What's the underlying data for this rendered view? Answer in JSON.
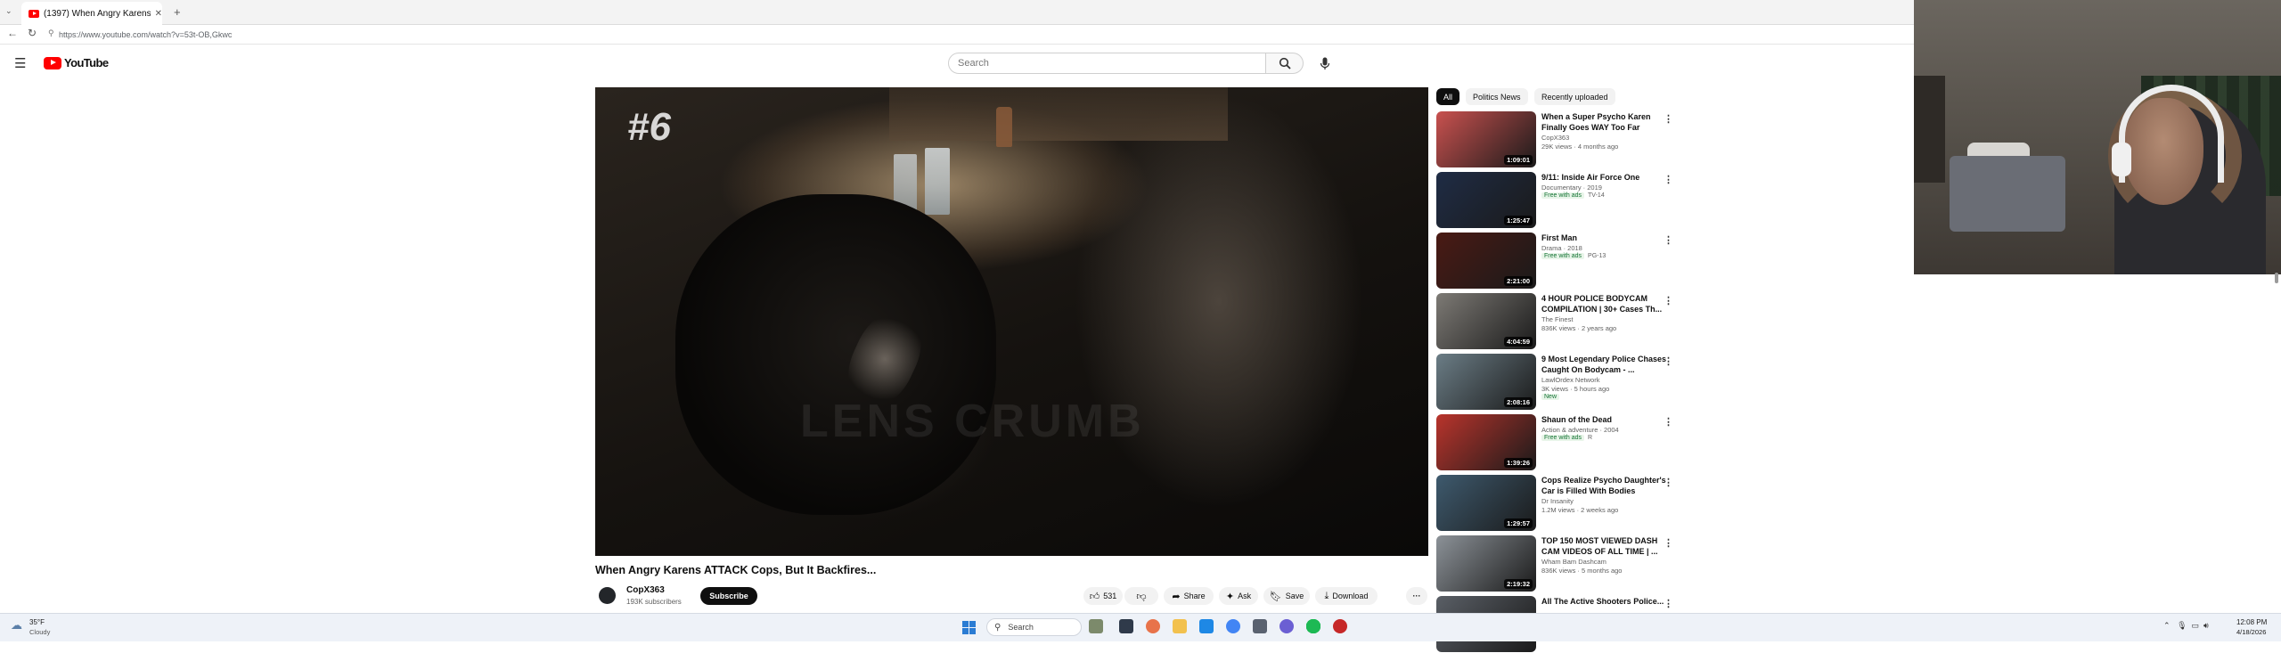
{
  "browser": {
    "tab_title": "(1397) When Angry Karens A",
    "url": "https://www.youtube.com/watch?v=53t-OB,Gkwc"
  },
  "header": {
    "logo_text": "YouTube",
    "search_placeholder": "Search"
  },
  "video": {
    "overlay_text": "#6",
    "title": "When Angry Karens ATTACK Cops, But It Backfires...",
    "channel": "CopX363",
    "subscribers": "193K subscribers",
    "subscribe_label": "Subscribe",
    "likes": "531",
    "share_label": "Share",
    "ask_label": "Ask",
    "save_label": "Save",
    "download_label": "Download"
  },
  "chips": [
    "All",
    "Politics News",
    "Recently uploaded"
  ],
  "recommendations": [
    {
      "title": "When a Super Psycho Karen Finally Goes WAY Too Far",
      "channel": "CopX363",
      "meta": "29K views · 4 months ago",
      "duration": "1:09:01",
      "badge": "",
      "rating": "",
      "thumb": "#c9514f"
    },
    {
      "title": "9/11: Inside Air Force One",
      "channel": "Documentary · 2019",
      "meta": "",
      "duration": "1:25:47",
      "badge": "Free with ads",
      "rating": "TV-14",
      "thumb": "#1f2c45"
    },
    {
      "title": "First Man",
      "channel": "Drama · 2018",
      "meta": "",
      "duration": "2:21:00",
      "badge": "Free with ads",
      "rating": "PG-13",
      "thumb": "#4a1a14"
    },
    {
      "title": "4 HOUR POLICE BODYCAM COMPILATION | 30+ Cases Th...",
      "channel": "The Finest",
      "meta": "836K views · 2 years ago",
      "duration": "4:04:59",
      "badge": "",
      "rating": "",
      "thumb": "#7d7a75"
    },
    {
      "title": "9 Most Legendary Police Chases Caught On Bodycam - ...",
      "channel": "LawlOrdex Network",
      "meta": "3K views · 5 hours ago",
      "duration": "2:08:16",
      "badge": "New",
      "rating": "",
      "thumb": "#6b7d86"
    },
    {
      "title": "Shaun of the Dead",
      "channel": "Action & adventure · 2004",
      "meta": "",
      "duration": "1:39:26",
      "badge": "Free with ads",
      "rating": "R",
      "thumb": "#b9342c"
    },
    {
      "title": "Cops Realize Psycho Daughter's Car is Filled With Bodies",
      "channel": "Dr Insanity",
      "meta": "1.2M views · 2 weeks ago",
      "duration": "1:29:57",
      "badge": "",
      "rating": "",
      "thumb": "#3e5a6e"
    },
    {
      "title": "TOP 150 MOST VIEWED DASH CAM VIDEOS OF ALL TIME | ...",
      "channel": "Wham Bam Dashcam",
      "meta": "836K views · 5 months ago",
      "duration": "2:19:32",
      "badge": "",
      "rating": "",
      "thumb": "#8c9298"
    },
    {
      "title": "All The Active Shooters Police...",
      "channel": "",
      "meta": "",
      "duration": "",
      "badge": "",
      "rating": "",
      "thumb": "#5a5f66"
    }
  ],
  "taskbar": {
    "temperature": "35°F",
    "condition": "Cloudy",
    "search_label": "Search",
    "time": "12:08 PM",
    "date": "4/18/2026"
  },
  "colors": {
    "brand_red": "#ff0000",
    "subscribe_bg": "#0f0f0f",
    "free_with_ads": "#137333",
    "windows_blue": "#2b7cd3"
  }
}
